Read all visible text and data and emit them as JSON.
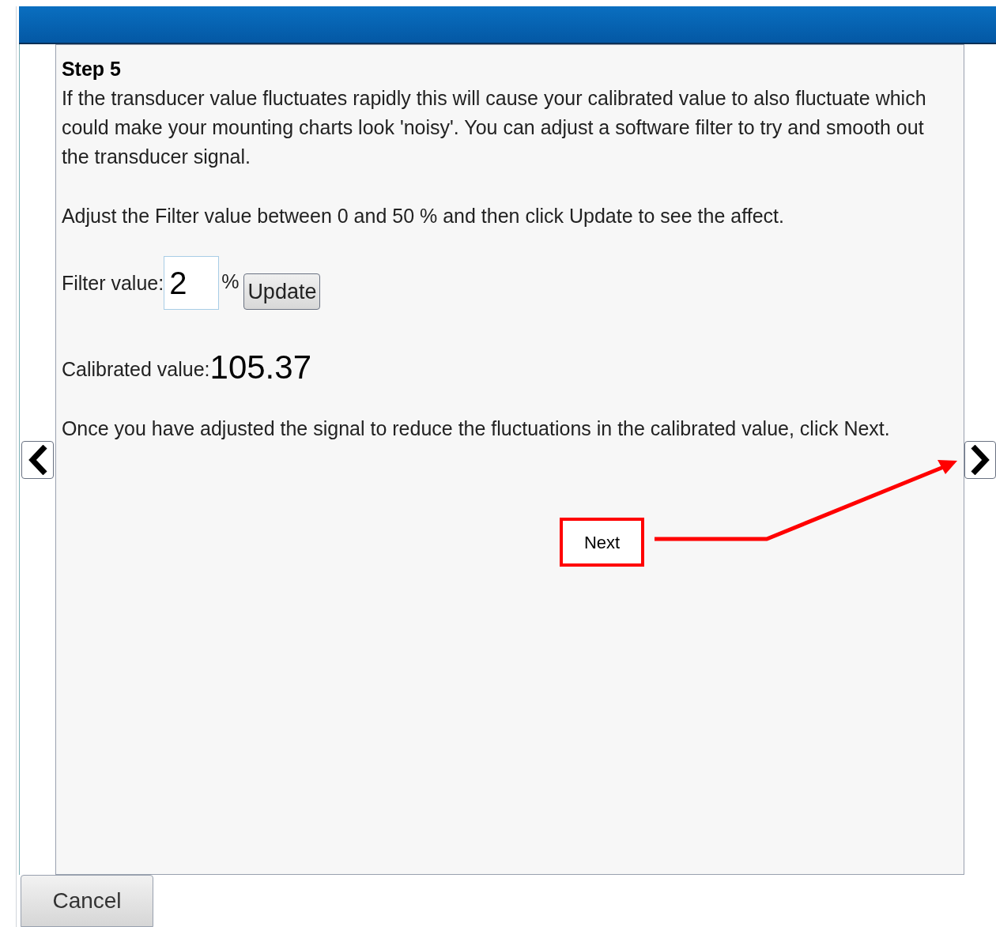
{
  "step": {
    "title": "Step 5",
    "intro": "If the transducer value fluctuates rapidly this will cause your calibrated value to also fluctuate which could make your mounting charts look 'noisy'. You can adjust a software filter to try and smooth out the transducer signal.",
    "instruction": "Adjust the Filter value between 0 and 50 % and then click Update to see the affect.",
    "filter": {
      "label": "Filter value:",
      "value": "2",
      "unit": "%",
      "button": "Update"
    },
    "calibrated": {
      "label": "Calibrated value:",
      "value": "105.37"
    },
    "outro": "Once you have adjusted the signal to reduce the fluctuations in the calibrated value, click Next."
  },
  "callout": {
    "label": "Next"
  },
  "buttons": {
    "cancel": "Cancel"
  }
}
